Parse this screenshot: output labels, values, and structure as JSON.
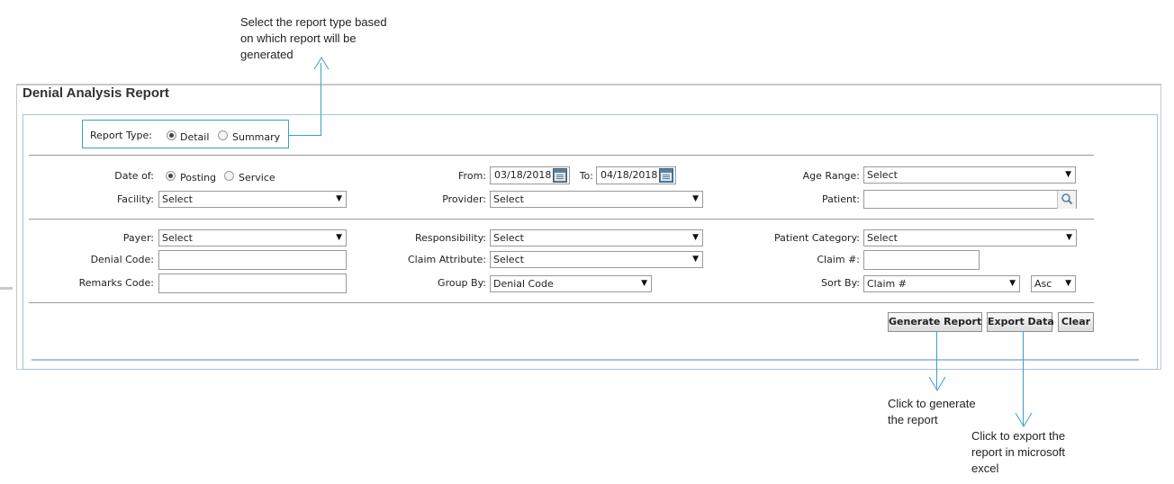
{
  "annotations": {
    "report_type_note": [
      "Select the report type based",
      "on which report will be",
      "generated"
    ],
    "generate_note": [
      "Click to generate",
      "the report"
    ],
    "export_note": [
      "Click to export the",
      "report in microsoft",
      "excel"
    ]
  },
  "page_title": "Denial Analysis Report",
  "report_type": {
    "label": "Report Type:",
    "options": [
      "Detail",
      "Summary"
    ],
    "selected": "Detail"
  },
  "filters": {
    "date_of": {
      "label": "Date of:",
      "options": [
        "Posting",
        "Service"
      ],
      "selected": "Posting"
    },
    "from": {
      "label": "From:",
      "value": "03/18/2018"
    },
    "to": {
      "label": "To:",
      "value": "04/18/2018"
    },
    "age_range": {
      "label": "Age Range:",
      "value": "Select"
    },
    "facility": {
      "label": "Facility:",
      "value": "Select"
    },
    "provider": {
      "label": "Provider:",
      "value": "Select"
    },
    "patient": {
      "label": "Patient:",
      "value": ""
    },
    "payer": {
      "label": "Payer:",
      "value": "Select"
    },
    "responsibility": {
      "label": "Responsibility:",
      "value": "Select"
    },
    "patient_category": {
      "label": "Patient Category:",
      "value": "Select"
    },
    "denial_code": {
      "label": "Denial Code:",
      "value": ""
    },
    "claim_attribute": {
      "label": "Claim Attribute:",
      "value": "Select"
    },
    "claim_no": {
      "label": "Claim #:",
      "value": ""
    },
    "remarks_code": {
      "label": "Remarks Code:",
      "value": ""
    },
    "group_by": {
      "label": "Group By:",
      "value": "Denial Code"
    },
    "sort_by": {
      "label": "Sort By:",
      "value": "Claim #"
    },
    "sort_order": {
      "value": "Asc"
    }
  },
  "buttons": {
    "generate": "Generate Report",
    "export": "Export Data",
    "clear": "Clear"
  },
  "colors": {
    "annotation_line": "#3aa0c8",
    "panel_border": "#a9c3d6"
  },
  "icons": {
    "calendar": "calendar-icon",
    "search": "search-icon",
    "dropdown": "chevron-down-icon"
  }
}
